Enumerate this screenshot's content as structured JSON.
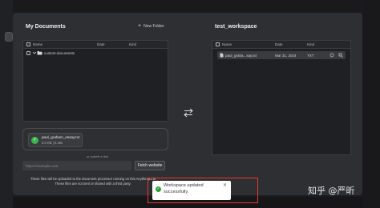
{
  "background": {
    "top_close_glyph": "✕"
  },
  "left": {
    "title": "My Documents",
    "new_folder_label": "New Folder",
    "columns": [
      "Name",
      "Date",
      "Kind"
    ],
    "rows": [
      {
        "name": "custom-documents"
      }
    ],
    "upload": {
      "file_name": "paul_graham_essay.txt",
      "file_size": "0.0 KB | 0.20s"
    },
    "or_submit": "or submit a link",
    "url_placeholder": "https://example.com",
    "fetch_label": "Fetch website",
    "notice_line1": "These files will be uploaded to the document processor running on this AnythingLLM",
    "notice_line2": "These files are not sent or shared with a third party."
  },
  "right": {
    "title": "test_workspace",
    "columns": [
      "Name",
      "Date",
      "Kind"
    ],
    "rows": [
      {
        "name": "paul_graha...say.txt",
        "date": "Mar 31, 2024",
        "kind": "TXT"
      }
    ]
  },
  "toast": {
    "message": "Workspace updated successfully."
  },
  "watermark": "知乎 @严昕",
  "colors": {
    "modal": "#2e2f32",
    "panel": "#1f2023",
    "success": "#2e9e3a",
    "highlight": "#e8382f"
  }
}
